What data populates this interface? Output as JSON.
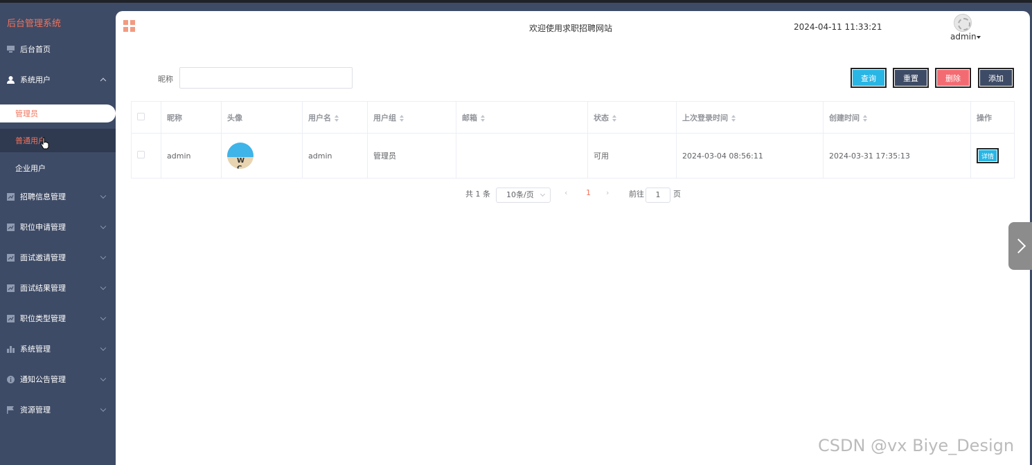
{
  "sidebar": {
    "brand": "后台管理系统",
    "items": [
      {
        "label": "后台首页",
        "icon": "monitor-icon"
      },
      {
        "label": "系统用户",
        "icon": "user-icon"
      },
      {
        "label": "招聘信息管理",
        "icon": "chart-icon"
      },
      {
        "label": "职位申请管理",
        "icon": "chart-icon"
      },
      {
        "label": "面试邀请管理",
        "icon": "chart-icon"
      },
      {
        "label": "面试结果管理",
        "icon": "chart-icon"
      },
      {
        "label": "职位类型管理",
        "icon": "chart-icon"
      },
      {
        "label": "系统管理",
        "icon": "bar-chart-icon"
      },
      {
        "label": "通知公告管理",
        "icon": "info-icon"
      },
      {
        "label": "资源管理",
        "icon": "flag-icon"
      }
    ],
    "submenu": [
      {
        "label": "管理员"
      },
      {
        "label": "普通用户"
      },
      {
        "label": "企业用户"
      }
    ]
  },
  "header": {
    "welcome": "欢迎使用求职招聘网站",
    "datetime": "2024-04-11 11:33:21",
    "user": "admin"
  },
  "filter": {
    "label": "昵称",
    "value": "",
    "placeholder": ""
  },
  "buttons": {
    "query": "查询",
    "reset": "重置",
    "delete": "删除",
    "add": "添加"
  },
  "table": {
    "columns": [
      "昵称",
      "头像",
      "用户名",
      "用户组",
      "邮箱",
      "状态",
      "上次登录时间",
      "创建时间",
      "操作"
    ],
    "rows": [
      {
        "nickname": "admin",
        "avatar_text": "W C",
        "username": "admin",
        "group": "管理员",
        "email": "",
        "status": "可用",
        "last_login": "2024-03-04 08:56:11",
        "created": "2024-03-31 17:35:13",
        "action": "详情"
      }
    ]
  },
  "pagination": {
    "total": "共 1 条",
    "page_size": "10条/页",
    "current": "1",
    "goto_label": "前往",
    "goto_value": "1",
    "page_label": "页"
  },
  "watermark": "CSDN @vx Biye_Design",
  "colors": {
    "sidebar": "#3e4b66",
    "accent": "#f2735b",
    "query": "#29b6e4",
    "delete": "#f36b72"
  }
}
